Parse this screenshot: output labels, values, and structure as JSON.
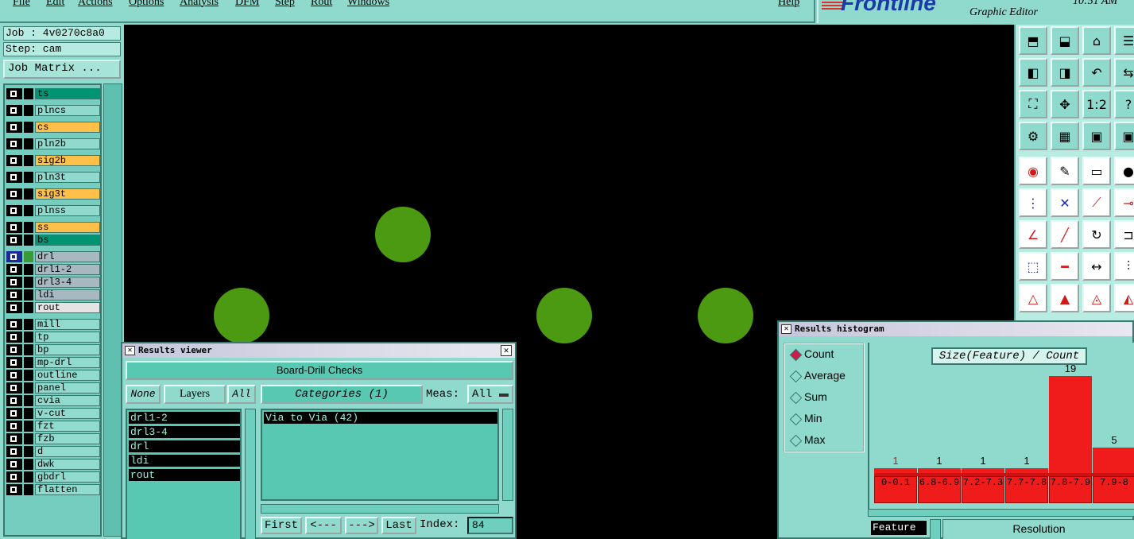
{
  "menu": [
    "File",
    "Edit",
    "Actions",
    "Options",
    "Analysis",
    "DFM",
    "Step",
    "Rout",
    "Windows",
    "Help"
  ],
  "brand": {
    "logo": "Frontline",
    "subtitle": "Graphic Editor",
    "clock": "10:51 AM"
  },
  "job": {
    "job_label": "Job : 4v0270c8a0",
    "step_label": "Step: cam",
    "matrix_button": "Job Matrix ..."
  },
  "layers": [
    {
      "name": "ts",
      "color": "#009473"
    },
    {
      "name": "plncs",
      "color": "#8fd9cd"
    },
    {
      "name": "cs",
      "color": "#ffc04a"
    },
    {
      "name": "pln2b",
      "color": "#8fd9cd"
    },
    {
      "name": "sig2b",
      "color": "#ffc04a"
    },
    {
      "name": "pln3t",
      "color": "#8fd9cd"
    },
    {
      "name": "sig3t",
      "color": "#ffc04a"
    },
    {
      "name": "plnss",
      "color": "#8fd9cd"
    },
    {
      "name": "ss",
      "color": "#ffc04a"
    },
    {
      "name": "bs",
      "color": "#009473"
    },
    {
      "name": "drl",
      "color": "#a8b8c0"
    },
    {
      "name": "drl1-2",
      "color": "#a8b8c0"
    },
    {
      "name": "drl3-4",
      "color": "#a8b8c0"
    },
    {
      "name": "ldi",
      "color": "#a8b8c0"
    },
    {
      "name": "rout",
      "color": "#e4e4e4"
    },
    {
      "name": "mill",
      "color": "#8fd9cd"
    },
    {
      "name": "tp",
      "color": "#8fd9cd"
    },
    {
      "name": "bp",
      "color": "#8fd9cd"
    },
    {
      "name": "mp-drl",
      "color": "#8fd9cd"
    },
    {
      "name": "outline",
      "color": "#8fd9cd"
    },
    {
      "name": "panel",
      "color": "#8fd9cd"
    },
    {
      "name": "cvia",
      "color": "#8fd9cd"
    },
    {
      "name": "v-cut",
      "color": "#8fd9cd"
    },
    {
      "name": "fzt",
      "color": "#8fd9cd"
    },
    {
      "name": "fzb",
      "color": "#8fd9cd"
    },
    {
      "name": "d",
      "color": "#8fd9cd"
    },
    {
      "name": "dwk",
      "color": "#8fd9cd"
    },
    {
      "name": "gbdrl",
      "color": "#8fd9cd"
    },
    {
      "name": "flatten",
      "color": "#8fd9cd"
    }
  ],
  "canvas": {
    "pad_color": "#4b9a12",
    "background": "#000000"
  },
  "tools": [
    [
      "home-icon",
      "window-icon",
      "house-icon",
      "menu-icon"
    ],
    [
      "pan-left-icon",
      "pan-right-icon",
      "undo-icon",
      "swap-icon"
    ],
    [
      "zoom-fit-icon",
      "zoom-center-icon",
      "ratio-icon",
      "help-icon"
    ],
    [
      "settings-icon",
      "grid-icon",
      "board-icon",
      "board2-icon"
    ],
    [
      "snap-icon",
      "edit-icon",
      "ruler-icon",
      "pad-icon"
    ],
    [
      "connect-icon",
      "delete-icon",
      "route-icon",
      "pin-icon"
    ],
    [
      "angle-icon",
      "line-icon",
      "arc-icon",
      "dimension-icon"
    ],
    [
      "move-icon",
      "line-red-icon",
      "measure-icon",
      "split-icon"
    ],
    [
      "triangle-icon",
      "triangle-up-icon",
      "area-icon",
      "area2-icon"
    ]
  ],
  "tool_labels": {
    "ratio": "1:2",
    "help": "?"
  },
  "results_viewer": {
    "title": "Results viewer",
    "banner": "Board-Drill Checks",
    "none_label": "None",
    "layers_label": "Layers",
    "all_label": "All",
    "categories_label": "Categories (1)",
    "meas_label": "Meas:",
    "meas_value": "All",
    "layers": [
      "drl1-2",
      "drl3-4",
      "drl",
      "ldi",
      "rout"
    ],
    "category_item": "Via to Via  (42)",
    "nav": {
      "first": "First",
      "prev": "<---",
      "next": "--->",
      "last": "Last"
    },
    "index_label": "Index:",
    "index_value": "84"
  },
  "results_histogram": {
    "title": "Results histogram",
    "modes": [
      "Count",
      "Average",
      "Sum",
      "Min",
      "Max"
    ],
    "selected_mode": "Count",
    "plot_title": "Size(Feature) / Count",
    "feature_label": "Feature",
    "resolution_label": "Resolution"
  },
  "chart_data": {
    "type": "bar",
    "title": "Size(Feature) / Count",
    "categories": [
      "0-0.1",
      "6.8-6.9",
      "7.2-7.3",
      "7.7-7.8",
      "7.8-7.9",
      "7.9-8"
    ],
    "values": [
      1,
      1,
      1,
      1,
      19,
      5
    ],
    "value_labels": [
      "1",
      "1",
      "1",
      "1",
      "19",
      "5"
    ],
    "ylim": [
      0,
      19
    ]
  }
}
